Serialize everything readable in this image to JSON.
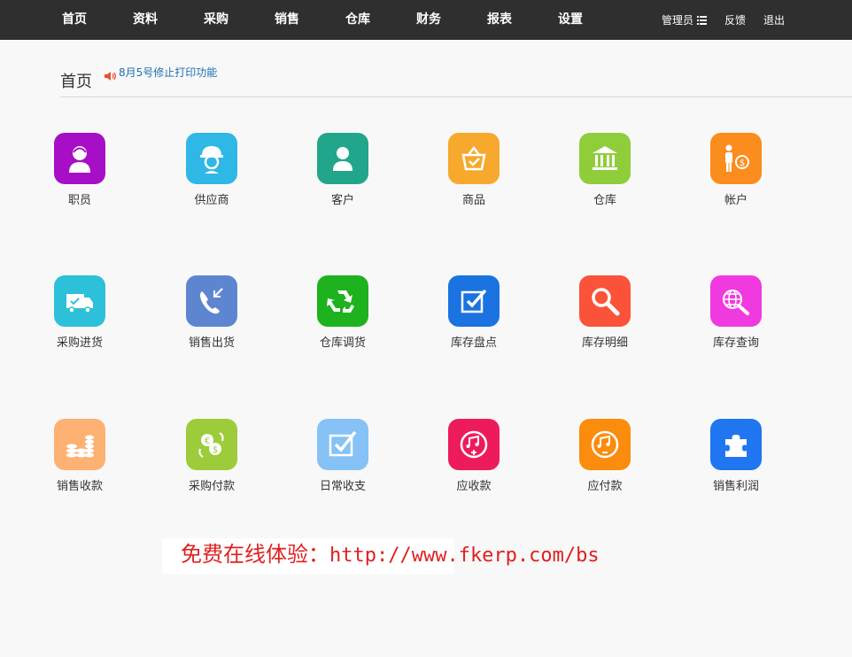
{
  "nav": {
    "items": [
      "首页",
      "资料",
      "采购",
      "销售",
      "仓库",
      "财务",
      "报表",
      "设置"
    ],
    "user": "管理员",
    "feedback": "反馈",
    "logout": "退出"
  },
  "header": {
    "title": "首页",
    "notice": "8月5号修止打印功能"
  },
  "tiles": [
    {
      "label": "职员",
      "icon": "staff-icon",
      "color": "#a70fc7"
    },
    {
      "label": "供应商",
      "icon": "supplier-icon",
      "color": "#2fb7e5"
    },
    {
      "label": "客户",
      "icon": "customer-icon",
      "color": "#21a68b"
    },
    {
      "label": "商品",
      "icon": "goods-icon",
      "color": "#f7a92d"
    },
    {
      "label": "仓库",
      "icon": "warehouse-icon",
      "color": "#8fcd3a"
    },
    {
      "label": "帐户",
      "icon": "account-icon",
      "color": "#fb8c1e"
    },
    {
      "label": "采购进货",
      "icon": "purchase-in-icon",
      "color": "#2cc1d8"
    },
    {
      "label": "销售出货",
      "icon": "sales-out-icon",
      "color": "#5e86d0"
    },
    {
      "label": "仓库调货",
      "icon": "transfer-icon",
      "color": "#1fb21f"
    },
    {
      "label": "库存盘点",
      "icon": "stocktake-icon",
      "color": "#1a73e0"
    },
    {
      "label": "库存明细",
      "icon": "stock-detail-icon",
      "color": "#fb5339"
    },
    {
      "label": "库存查询",
      "icon": "stock-query-icon",
      "color": "#f03ae0"
    },
    {
      "label": "销售收款",
      "icon": "sales-receipt-icon",
      "color": "#fdb173"
    },
    {
      "label": "采购付款",
      "icon": "purchase-payment-icon",
      "color": "#9ccc3a"
    },
    {
      "label": "日常收支",
      "icon": "daily-io-icon",
      "color": "#86c2f5"
    },
    {
      "label": "应收款",
      "icon": "receivable-icon",
      "color": "#ee1b5c"
    },
    {
      "label": "应付款",
      "icon": "payable-icon",
      "color": "#fb8c0d"
    },
    {
      "label": "销售利润",
      "icon": "sales-profit-icon",
      "color": "#1f76f0"
    }
  ],
  "promo": {
    "prefix": "免费在线体验：",
    "url": "http://www.fkerp.com/bs"
  }
}
